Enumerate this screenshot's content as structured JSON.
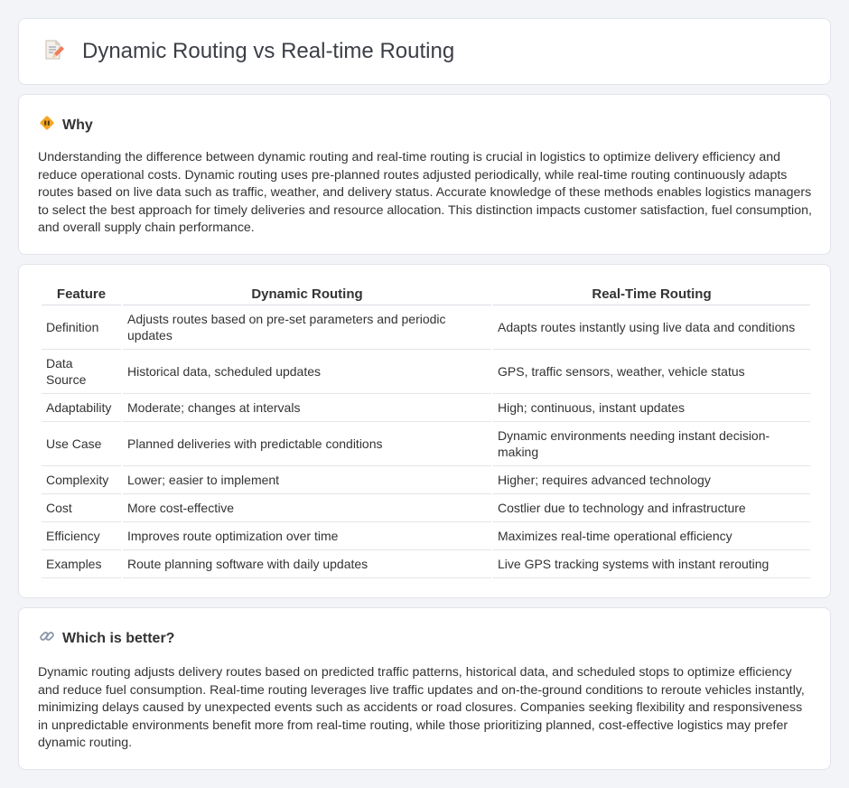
{
  "header": {
    "title": "Dynamic Routing vs Real-time Routing",
    "icon": "memo-pencil-icon"
  },
  "why": {
    "heading": "Why",
    "icon": "diamond-warning-icon",
    "text": "Understanding the difference between dynamic routing and real-time routing is crucial in logistics to optimize delivery efficiency and reduce operational costs. Dynamic routing uses pre-planned routes adjusted periodically, while real-time routing continuously adapts routes based on live data such as traffic, weather, and delivery status. Accurate knowledge of these methods enables logistics managers to select the best approach for timely deliveries and resource allocation. This distinction impacts customer satisfaction, fuel consumption, and overall supply chain performance."
  },
  "table": {
    "headers": [
      "Feature",
      "Dynamic Routing",
      "Real-Time Routing"
    ],
    "rows": [
      [
        "Definition",
        "Adjusts routes based on pre-set parameters and periodic updates",
        "Adapts routes instantly using live data and conditions"
      ],
      [
        "Data Source",
        "Historical data, scheduled updates",
        "GPS, traffic sensors, weather, vehicle status"
      ],
      [
        "Adaptability",
        "Moderate; changes at intervals",
        "High; continuous, instant updates"
      ],
      [
        "Use Case",
        "Planned deliveries with predictable conditions",
        "Dynamic environments needing instant decision-making"
      ],
      [
        "Complexity",
        "Lower; easier to implement",
        "Higher; requires advanced technology"
      ],
      [
        "Cost",
        "More cost-effective",
        "Costlier due to technology and infrastructure"
      ],
      [
        "Efficiency",
        "Improves route optimization over time",
        "Maximizes real-time operational efficiency"
      ],
      [
        "Examples",
        "Route planning software with daily updates",
        "Live GPS tracking systems with instant rerouting"
      ]
    ]
  },
  "better": {
    "heading": "Which is better?",
    "icon": "link-icon",
    "text": "Dynamic routing adjusts delivery routes based on predicted traffic patterns, historical data, and scheduled stops to optimize efficiency and reduce fuel consumption. Real-time routing leverages live traffic updates and on-the-ground conditions to reroute vehicles instantly, minimizing delays caused by unexpected events such as accidents or road closures. Companies seeking flexibility and responsiveness in unpredictable environments benefit more from real-time routing, while those prioritizing planned, cost-effective logistics may prefer dynamic routing."
  }
}
